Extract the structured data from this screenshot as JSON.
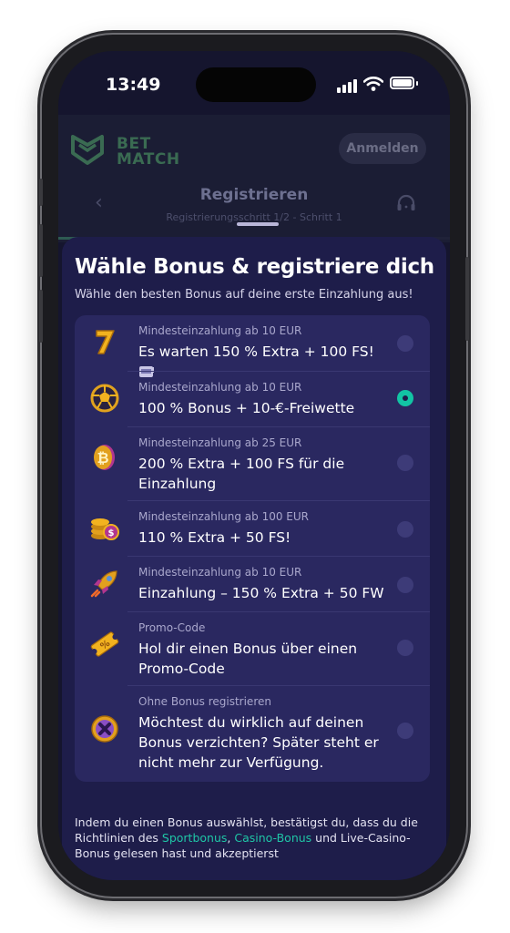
{
  "status_bar": {
    "time": "13:49"
  },
  "header": {
    "logo_top": "BET",
    "logo_bottom": "MATCH",
    "login_label": "Anmelden"
  },
  "nav": {
    "title": "Registrieren",
    "subtitle": "Registrierungsschritt 1/2 - Schritt 1"
  },
  "sheet": {
    "title": "Wähle Bonus & registriere dich",
    "subtitle": "Wähle den besten Bonus auf deine erste Einzahlung aus!"
  },
  "bonuses": [
    {
      "label": "Mindesteinzahlung ab 10 EUR",
      "text": "Es warten 150 % Extra + 100 FS!",
      "icon": "slot-seven-icon",
      "selected": false
    },
    {
      "label": "Mindesteinzahlung ab 10 EUR",
      "text": "100 % Bonus + 10-€-Freiwette",
      "icon": "soccer-ball-icon",
      "selected": true
    },
    {
      "label": "Mindesteinzahlung ab 25 EUR",
      "text": "200 % Extra + 100 FS für die Einzahlung",
      "icon": "bitcoin-coin-icon",
      "selected": false
    },
    {
      "label": "Mindesteinzahlung ab 100 EUR",
      "text": "110 % Extra + 50 FS!",
      "icon": "coin-stack-icon",
      "selected": false
    },
    {
      "label": "Mindesteinzahlung ab 10 EUR",
      "text": "Einzahlung – 150 % Extra + 50 FW",
      "icon": "rocket-icon",
      "selected": false
    },
    {
      "label": "Promo-Code",
      "text": "Hol dir einen Bonus über einen Promo-Code",
      "icon": "ticket-icon",
      "selected": false
    },
    {
      "label": "Ohne Bonus registrieren",
      "text": "Möchtest du wirklich auf deinen Bonus verzichten? Später steht er nicht mehr zur Verfügung.",
      "icon": "cross-coin-icon",
      "selected": false
    }
  ],
  "footer": {
    "text_before": "Indem du einen Bonus auswählst, bestätigst du, dass du die Richtlinien des ",
    "link_sport": "Sportbonus",
    "sep": ", ",
    "link_casino": "Casino-Bonus",
    "text_after": " und Live-Casino-Bonus gelesen hast und akzeptierst"
  },
  "colors": {
    "accent": "#12c4a4",
    "sheet_bg": "#1e1d4a",
    "list_bg": "#2a2860"
  }
}
